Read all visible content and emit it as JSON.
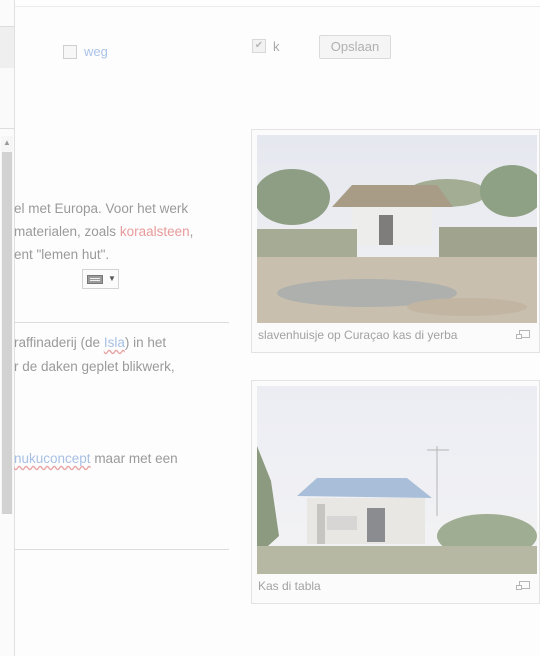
{
  "toolbar": {
    "weg_label": "weg",
    "k_label": "k",
    "save_label": "Opslaan"
  },
  "article": {
    "line1": "el met Europa. Voor het werk",
    "line2_pre": " materialen, zoals ",
    "line2_link": "koraalsteen",
    "line2_post": ",",
    "line3": "ent \"lemen hut\".",
    "line4_pre": "raffinaderij (de ",
    "line4_link": "Isla",
    "line4_post": ") in het",
    "line5": "r de daken geplet blikwerk,",
    "line6_link": "nukuconcept",
    "line6_post": " maar met een"
  },
  "images": [
    {
      "caption": "slavenhuisje op Curaçao kas di yerba"
    },
    {
      "caption": "Kas di tabla"
    }
  ],
  "colors": {
    "red_link": "#e89a9a",
    "blue_link": "#a8c0e4",
    "text": "#9a9a9a"
  },
  "icons": {
    "keyboard": "keyboard-icon",
    "magnify": "magnify-icon",
    "scroll_up": "scroll-up-arrow-icon",
    "checkmark": "checkmark-icon"
  }
}
